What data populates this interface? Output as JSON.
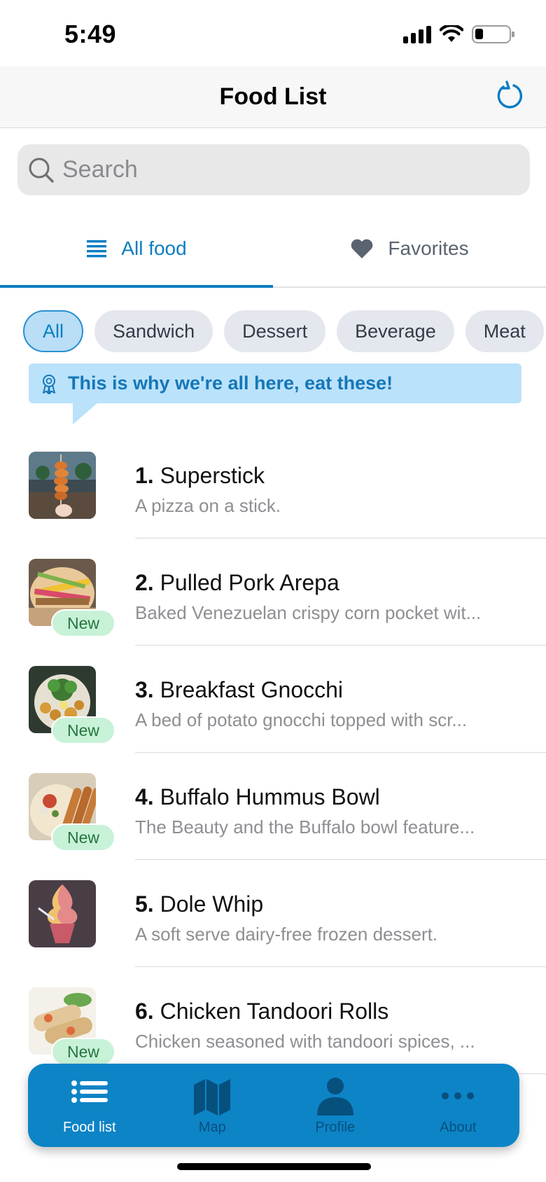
{
  "status_bar": {
    "time": "5:49"
  },
  "header": {
    "title": "Food List"
  },
  "search": {
    "placeholder": "Search"
  },
  "tabs": [
    {
      "label": "All food",
      "icon": "list-icon",
      "active": true
    },
    {
      "label": "Favorites",
      "icon": "heart-icon",
      "active": false
    }
  ],
  "categories": [
    "All",
    "Sandwich",
    "Dessert",
    "Beverage",
    "Meat"
  ],
  "selected_category": "All",
  "tooltip": {
    "text": "This is why we're all here, eat these!",
    "icon": "award-icon"
  },
  "foods": [
    {
      "number": "1.",
      "name": "Superstick",
      "description": "A pizza on a stick.",
      "badge": ""
    },
    {
      "number": "2.",
      "name": "Pulled Pork Arepa",
      "description": "Baked Venezuelan crispy corn pocket wit...",
      "badge": "New"
    },
    {
      "number": "3.",
      "name": "Breakfast Gnocchi",
      "description": "A bed of potato gnocchi topped with scr...",
      "badge": "New"
    },
    {
      "number": "4.",
      "name": "Buffalo Hummus Bowl",
      "description": "The Beauty and the Buffalo bowl feature...",
      "badge": "New"
    },
    {
      "number": "5.",
      "name": "Dole Whip",
      "description": "A soft serve dairy-free frozen dessert.",
      "badge": ""
    },
    {
      "number": "6.",
      "name": "Chicken Tandoori Rolls",
      "description": "Chicken seasoned with tandoori spices, ...",
      "badge": "New"
    }
  ],
  "tab_bar": [
    {
      "label": "Food list",
      "icon": "list-icon",
      "active": true
    },
    {
      "label": "Map",
      "icon": "map-icon",
      "active": false
    },
    {
      "label": "Profile",
      "icon": "person-icon",
      "active": false
    },
    {
      "label": "About",
      "icon": "more-icon",
      "active": false
    }
  ],
  "colors": {
    "accent": "#0a7dc2",
    "tab_bar_background": "#0d84c6",
    "tooltip_background": "#bbe2fb",
    "new_badge_background": "#c8f2d8"
  }
}
